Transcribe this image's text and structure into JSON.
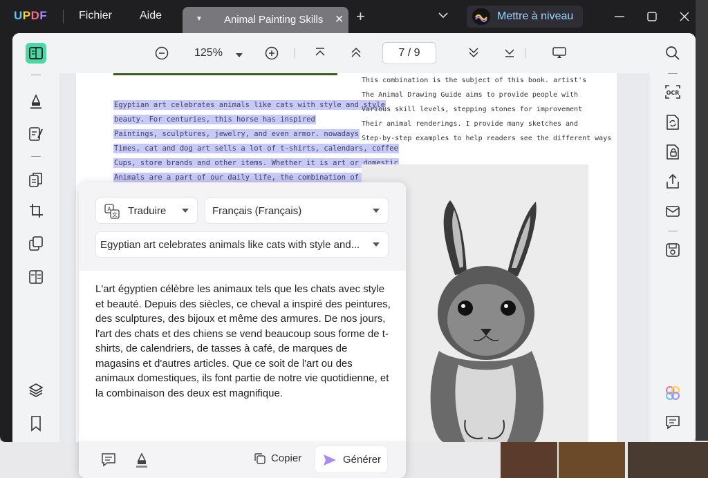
{
  "app": {
    "logo": {
      "u": "U",
      "p": "P",
      "d": "D",
      "f": "F"
    },
    "menu": {
      "file": "Fichier",
      "help": "Aide"
    },
    "tab_title": "Animal Painting Skills",
    "upgrade_label": "Mettre à niveau",
    "colors": {
      "accent": "#a78bfa",
      "highlight": "#c7c9f7",
      "titlebar": "#1f1f22"
    }
  },
  "toolbar": {
    "zoom": "125%",
    "page_current": "7",
    "page_sep": "/",
    "page_total": "9"
  },
  "document": {
    "highlighted_lines": [
      "Egyptian art celebrates animals like cats with style and style",
      "beauty. For centuries, this horse has inspired",
      "Paintings, sculptures, jewelry, and even armor. nowadays",
      "Times, cat and dog art sells a lot of t-shirts, calendars, coffee",
      "Cups, store brands and other items. Whether it is art or domestic",
      "Animals are a part of our daily life, the combination of the two"
    ],
    "right_lines": [
      "This combination is the subject of this book. artist's",
      "The Animal Drawing Guide aims to provide people with",
      "Various skill levels, stepping stones for improvement",
      "Their animal renderings. I provide many sketches and",
      "Step-by-step examples to help readers see the different ways"
    ]
  },
  "translate_panel": {
    "mode_label": "Traduire",
    "language_label": "Français (Français)",
    "source_text": "Egyptian art celebrates animals like cats with style and...",
    "result": "L'art égyptien célèbre les animaux tels que les chats avec style et beauté. Depuis des siècles, ce cheval a inspiré des peintures, des sculptures, des bijoux et même des armures. De nos jours, l'art des chats et des chiens se vend beaucoup sous forme de t-shirts, de calendriers, de tasses à café, de marques de magasins et d'autres articles. Que ce soit de l'art ou des animaux domestiques, ils font partie de notre vie quotidienne, et la combinaison des deux est magnifique.",
    "copy_label": "Copier",
    "generate_label": "Générer"
  },
  "icons": {
    "left_sidebar": [
      "reader-icon",
      "highlighter-icon",
      "edit-text-icon",
      "pages-icon",
      "crop-icon",
      "convert-icon",
      "form-icon",
      "layers-icon",
      "bookmark-icon"
    ],
    "right_sidebar": [
      "search-icon",
      "ocr-icon",
      "convert-pdf-icon",
      "protect-icon",
      "share-icon",
      "email-icon",
      "save-icon",
      "ai-assistant-icon",
      "comment-icon"
    ]
  }
}
